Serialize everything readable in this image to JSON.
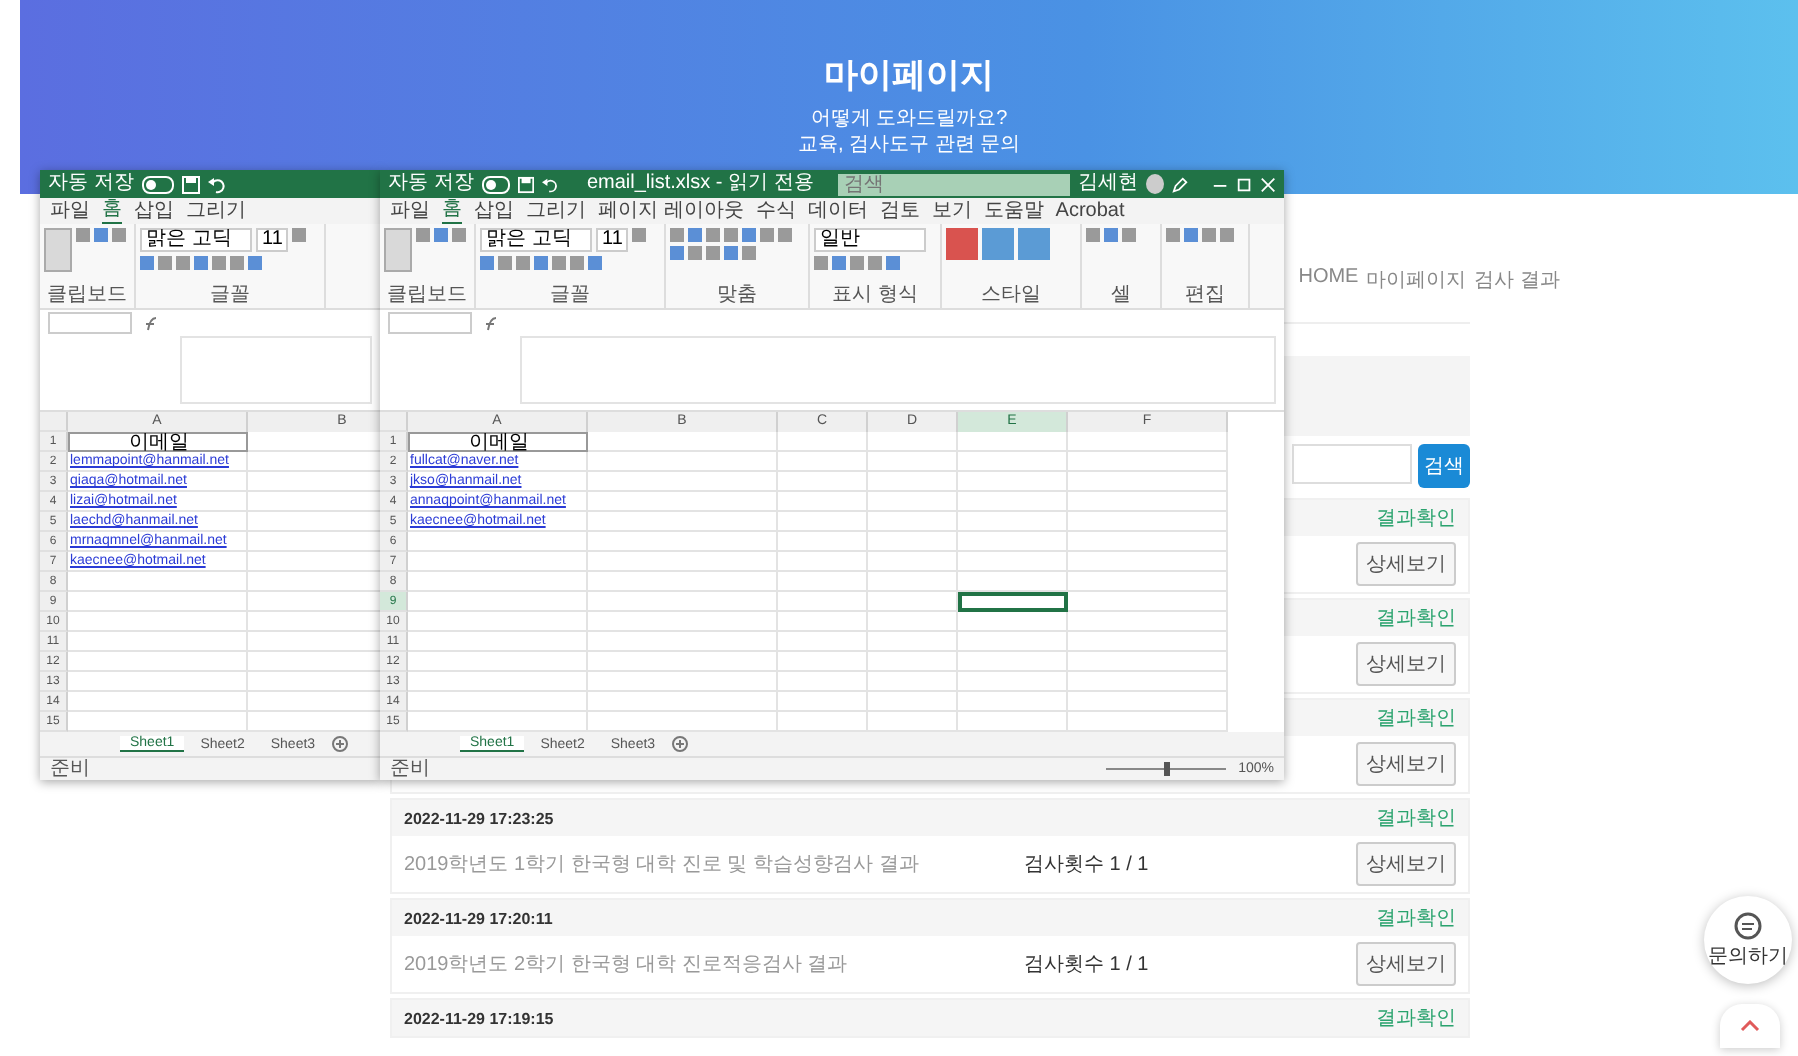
{
  "banner": {
    "title": "마이페이지",
    "subtitle_lines": [
      "어떻게 도와드릴까요?",
      "교육, 검사도구 관련 문의"
    ]
  },
  "breadcrumb": [
    "HOME",
    "마이페이지",
    "검사 결과"
  ],
  "search": {
    "button": "검색"
  },
  "results": [
    {
      "status": "결과확인",
      "button": "상세보기"
    },
    {
      "status": "결과확인",
      "button": "상세보기"
    },
    {
      "status": "결과확인",
      "button": "상세보기"
    },
    {
      "date": "2022-11-29 17:23:25",
      "title": "2019학년도 1학기 한국형 대학 진로 및 학습성향검사 결과",
      "count": "검사횟수 1 / 1",
      "status": "결과확인",
      "button": "상세보기"
    },
    {
      "date": "2022-11-29 17:20:11",
      "title": "2019학년도 2학기 한국형 대학 진로적응검사 결과",
      "count": "검사횟수 1 / 1",
      "status": "결과확인",
      "button": "상세보기"
    },
    {
      "date": "2022-11-29 17:19:15",
      "status": "결과확인"
    }
  ],
  "excel_windows": [
    {
      "autosave_label": "자동 저장",
      "autosave_on": false,
      "ribbon_tabs": [
        {
          "label": "파일",
          "selected": false
        },
        {
          "label": "홈",
          "selected": true
        },
        {
          "label": "삽입",
          "selected": false
        },
        {
          "label": "그리기",
          "selected": false
        }
      ],
      "ribbon_groups": [
        {
          "kind": "clipboard",
          "label": "클립보드"
        },
        {
          "kind": "font",
          "label": "글꼴"
        }
      ],
      "font_name": "맑은 고딕",
      "font_size": "11",
      "columns": [
        {
          "label": "A",
          "selected": false
        },
        {
          "label": "B",
          "selected": false
        }
      ],
      "rows": [
        {
          "number": "1",
          "value": "이메일",
          "selected": false
        },
        {
          "number": "2",
          "value": "lemmapoint@hanmail.net",
          "selected": false
        },
        {
          "number": "3",
          "value": "qiaqa@hotmail.net",
          "selected": false
        },
        {
          "number": "4",
          "value": "lizai@hotmail.net",
          "selected": false
        },
        {
          "number": "5",
          "value": "laechd@hanmail.net",
          "selected": false
        },
        {
          "number": "6",
          "value": "mrnaqmnel@hanmail.net",
          "selected": false
        },
        {
          "number": "7",
          "value": "kaecnee@hotmail.net",
          "selected": false
        },
        {
          "number": "8",
          "selected": false
        },
        {
          "number": "9",
          "selected": false
        },
        {
          "number": "10",
          "selected": false
        },
        {
          "number": "11",
          "selected": false
        },
        {
          "number": "12",
          "selected": false
        },
        {
          "number": "13",
          "selected": false
        },
        {
          "number": "14",
          "selected": false
        },
        {
          "number": "15",
          "selected": false
        }
      ],
      "sheet_tabs": [
        {
          "label": "Sheet1",
          "selected": true
        },
        {
          "label": "Sheet2",
          "selected": false
        },
        {
          "label": "Sheet3",
          "selected": false
        }
      ],
      "status": "준비"
    },
    {
      "autosave_label": "자동 저장",
      "autosave_on": false,
      "file_name": "email_list.xlsx - 읽기 전용",
      "search_placeholder": "검색",
      "user_name": "김세현",
      "ribbon_tabs": [
        {
          "label": "파일",
          "selected": false
        },
        {
          "label": "홈",
          "selected": true
        },
        {
          "label": "삽입",
          "selected": false
        },
        {
          "label": "그리기",
          "selected": false
        },
        {
          "label": "페이지 레이아웃",
          "selected": false
        },
        {
          "label": "수식",
          "selected": false
        },
        {
          "label": "데이터",
          "selected": false
        },
        {
          "label": "검토",
          "selected": false
        },
        {
          "label": "보기",
          "selected": false
        },
        {
          "label": "도움말",
          "selected": false
        },
        {
          "label": "Acrobat",
          "selected": false
        }
      ],
      "ribbon_groups": [
        {
          "kind": "clipboard",
          "label": "클립보드"
        },
        {
          "kind": "font",
          "label": "글꼴"
        },
        {
          "kind": "alignment",
          "label": "맞춤"
        },
        {
          "kind": "number",
          "label": "표시 형식"
        },
        {
          "kind": "styles",
          "label": "스타일"
        },
        {
          "kind": "cells",
          "label": "셀"
        },
        {
          "kind": "editing",
          "label": "편집"
        }
      ],
      "font_name": "맑은 고딕",
      "font_size": "11",
      "number_format": "일반",
      "columns": [
        {
          "label": "A",
          "selected": false
        },
        {
          "label": "B",
          "selected": false
        },
        {
          "label": "C",
          "selected": false
        },
        {
          "label": "D",
          "selected": false
        },
        {
          "label": "E",
          "selected": true
        },
        {
          "label": "F",
          "selected": false
        }
      ],
      "rows": [
        {
          "number": "1",
          "value": "이메일",
          "selected": false
        },
        {
          "number": "2",
          "value": "fullcat@naver.net",
          "selected": false
        },
        {
          "number": "3",
          "value": "jkso@hanmail.net",
          "selected": false
        },
        {
          "number": "4",
          "value": "annaqpoint@hanmail.net",
          "selected": false
        },
        {
          "number": "5",
          "value": "kaecnee@hotmail.net",
          "selected": false
        },
        {
          "number": "6",
          "selected": false
        },
        {
          "number": "7",
          "selected": false
        },
        {
          "number": "8",
          "selected": false
        },
        {
          "number": "9",
          "selected": true
        },
        {
          "number": "10",
          "selected": false
        },
        {
          "number": "11",
          "selected": false
        },
        {
          "number": "12",
          "selected": false
        },
        {
          "number": "13",
          "selected": false
        },
        {
          "number": "14",
          "selected": false
        },
        {
          "number": "15",
          "selected": false
        }
      ],
      "sheet_tabs": [
        {
          "label": "Sheet1",
          "selected": true
        },
        {
          "label": "Sheet2",
          "selected": false
        },
        {
          "label": "Sheet3",
          "selected": false
        }
      ],
      "status": "준비",
      "zoom": {
        "level": 0.5,
        "reading": "100%"
      }
    }
  ],
  "chat_button": {
    "label": "문의하기"
  }
}
